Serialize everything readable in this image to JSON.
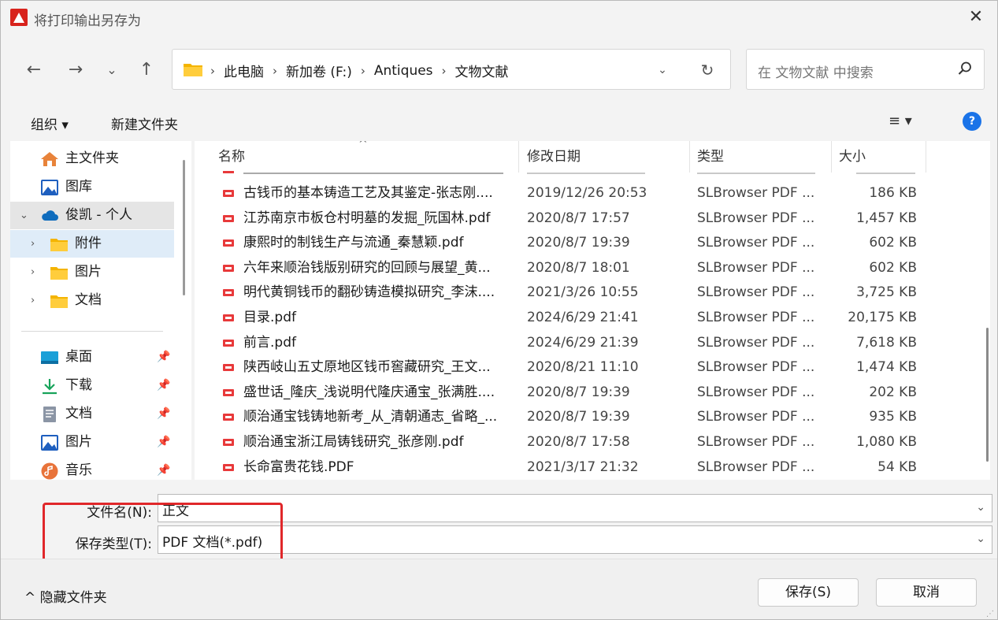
{
  "title": "将打印输出另存为",
  "close_glyph": "✕",
  "nav": {
    "back": "←",
    "forward": "→",
    "recent": "⌄",
    "up": "↑",
    "breadcrumbs": [
      "此电脑",
      "新加卷 (F:)",
      "Antiques",
      "文物文献"
    ],
    "breadcrumb_sep": "›",
    "dropdown_glyph": "⌄",
    "refresh_glyph": "↻",
    "search_placeholder": "在 文物文献 中搜索"
  },
  "toolbar": {
    "organize": "组织 ▾",
    "new_folder": "新建文件夹",
    "view_glyph": "≡ ▾",
    "help_glyph": "?"
  },
  "sidebar": {
    "quick": [
      {
        "label": "主文件夹"
      },
      {
        "label": "图库"
      },
      {
        "label": "俊凯 - 个人"
      },
      {
        "label": "附件"
      },
      {
        "label": "图片"
      },
      {
        "label": "文档"
      }
    ],
    "pinned": [
      {
        "label": "桌面"
      },
      {
        "label": "下载"
      },
      {
        "label": "文档"
      },
      {
        "label": "图片"
      },
      {
        "label": "音乐"
      }
    ],
    "pin_glyph": "📌",
    "expand_glyph": "›",
    "collapse_glyph": "⌄"
  },
  "columns": {
    "name": "名称",
    "date": "修改日期",
    "type": "类型",
    "size": "大小",
    "sort_glyph": "^"
  },
  "files": [
    {
      "name": "古钱币的基本铸造工艺及其鉴定-张志刚....",
      "date": "2019/12/26 20:53",
      "type": "SLBrowser PDF ...",
      "size": "186 KB"
    },
    {
      "name": "江苏南京市板仓村明墓的发掘_阮国林.pdf",
      "date": "2020/8/7 17:57",
      "type": "SLBrowser PDF ...",
      "size": "1,457 KB"
    },
    {
      "name": "康熙时的制钱生产与流通_秦慧颖.pdf",
      "date": "2020/8/7 19:39",
      "type": "SLBrowser PDF ...",
      "size": "602 KB"
    },
    {
      "name": "六年来顺治钱版别研究的回顾与展望_黄...",
      "date": "2020/8/7 18:01",
      "type": "SLBrowser PDF ...",
      "size": "602 KB"
    },
    {
      "name": "明代黄铜钱币的翻砂铸造模拟研究_李沫....",
      "date": "2021/3/26 10:55",
      "type": "SLBrowser PDF ...",
      "size": "3,725 KB"
    },
    {
      "name": "目录.pdf",
      "date": "2024/6/29 21:41",
      "type": "SLBrowser PDF ...",
      "size": "20,175 KB"
    },
    {
      "name": "前言.pdf",
      "date": "2024/6/29 21:39",
      "type": "SLBrowser PDF ...",
      "size": "7,618 KB"
    },
    {
      "name": "陕西岐山五丈原地区钱币窖藏研究_王文...",
      "date": "2020/8/21 11:10",
      "type": "SLBrowser PDF ...",
      "size": "1,474 KB"
    },
    {
      "name": "盛世话_隆庆_浅说明代隆庆通宝_张满胜....",
      "date": "2020/8/7 19:39",
      "type": "SLBrowser PDF ...",
      "size": "202 KB"
    },
    {
      "name": "顺治通宝钱铸地新考_从_清朝通志_省略_...",
      "date": "2020/8/7 19:39",
      "type": "SLBrowser PDF ...",
      "size": "935 KB"
    },
    {
      "name": "顺治通宝浙江局铸钱研究_张彦刚.pdf",
      "date": "2020/8/7 17:58",
      "type": "SLBrowser PDF ...",
      "size": "1,080 KB"
    },
    {
      "name": "长命富贵花钱.PDF",
      "date": "2021/3/17 21:32",
      "type": "SLBrowser PDF ...",
      "size": "54 KB"
    }
  ],
  "form": {
    "filename_label": "文件名(N):",
    "filename_value": "正文",
    "filetype_label": "保存类型(T):",
    "filetype_value": "PDF 文档(*.pdf)",
    "drop_glyph": "⌄"
  },
  "footer": {
    "hide_folders": "^ 隐藏文件夹",
    "save": "保存(S)",
    "cancel": "取消"
  },
  "colors": {
    "highlight": "#e0272a",
    "accent": "#1a73e8",
    "pdf_icon": "#e8393a"
  }
}
